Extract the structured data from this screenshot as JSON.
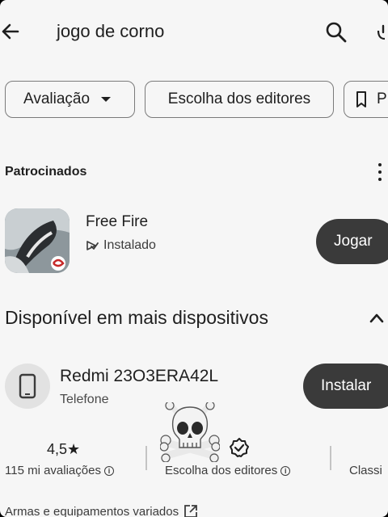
{
  "header": {
    "search_query": "jogo de corno"
  },
  "filters": {
    "rating_label": "Avaliação",
    "editors_label": "Escolha dos editores",
    "partial_label": "P"
  },
  "sponsored": {
    "heading": "Patrocinados",
    "app_name": "Free Fire",
    "status": "Instalado",
    "play_label": "Jogar"
  },
  "devices": {
    "heading": "Disponível em mais dispositivos",
    "device_name": "Redmi 23O3ERA42L",
    "device_type": "Telefone",
    "install_label": "Instalar"
  },
  "stats": {
    "rating_value": "4,5★",
    "rating_label": "115 mi avaliações",
    "editors_label": "Escolha dos editores",
    "partial_label": "Classi"
  },
  "footer": {
    "tags_label": "Armas e equipamentos variados"
  },
  "colors": {
    "background": "#f6f6f6",
    "button": "#3a3a3a",
    "text": "#1f1f1f"
  }
}
